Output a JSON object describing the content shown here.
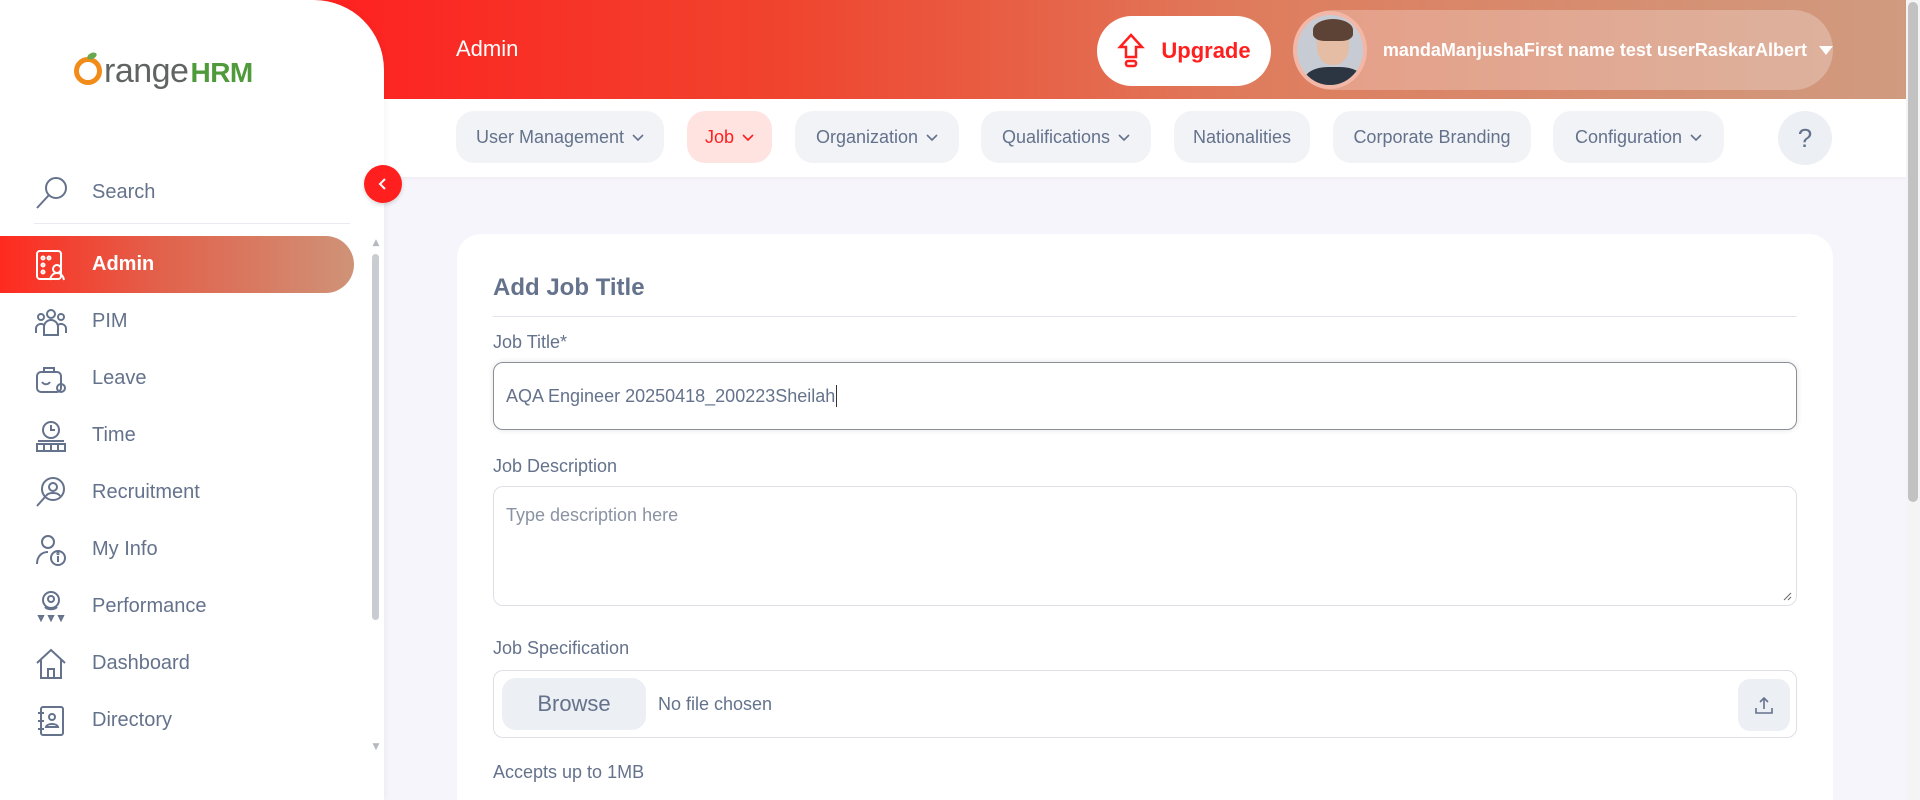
{
  "brand": {
    "logo_text_1": "range",
    "logo_text_2": "HRM",
    "logo_alt": "OrangeHRM"
  },
  "sidebar": {
    "search_label": "Search",
    "items": [
      {
        "label": "Admin",
        "icon": "admin-icon",
        "active": true
      },
      {
        "label": "PIM",
        "icon": "pim-icon"
      },
      {
        "label": "Leave",
        "icon": "leave-icon"
      },
      {
        "label": "Time",
        "icon": "time-icon"
      },
      {
        "label": "Recruitment",
        "icon": "recruitment-icon"
      },
      {
        "label": "My Info",
        "icon": "my-info-icon"
      },
      {
        "label": "Performance",
        "icon": "performance-icon"
      },
      {
        "label": "Dashboard",
        "icon": "dashboard-icon"
      },
      {
        "label": "Directory",
        "icon": "directory-icon"
      }
    ]
  },
  "header": {
    "title": "Admin",
    "upgrade_label": "Upgrade",
    "username": "mandaManjushaFirst name test userRaskarAlbert"
  },
  "subnav": {
    "tabs": [
      {
        "label": "User Management",
        "dropdown": true
      },
      {
        "label": "Job",
        "dropdown": true,
        "active": true
      },
      {
        "label": "Organization",
        "dropdown": true
      },
      {
        "label": "Qualifications",
        "dropdown": true
      },
      {
        "label": "Nationalities",
        "dropdown": false
      },
      {
        "label": "Corporate Branding",
        "dropdown": false
      },
      {
        "label": "Configuration",
        "dropdown": true
      }
    ],
    "help_label": "?"
  },
  "form": {
    "title": "Add Job Title",
    "job_title_label": "Job Title*",
    "job_title_value": "AQA Engineer 20250418_200223Sheilah",
    "job_description_label": "Job Description",
    "job_description_placeholder": "Type description here",
    "job_specification_label": "Job Specification",
    "browse_label": "Browse",
    "no_file_label": "No file chosen",
    "accepts_hint": "Accepts up to 1MB"
  },
  "colors": {
    "accent": "#ff1f1f",
    "text": "#64728c",
    "active_tab_bg": "#ffe3e1"
  }
}
